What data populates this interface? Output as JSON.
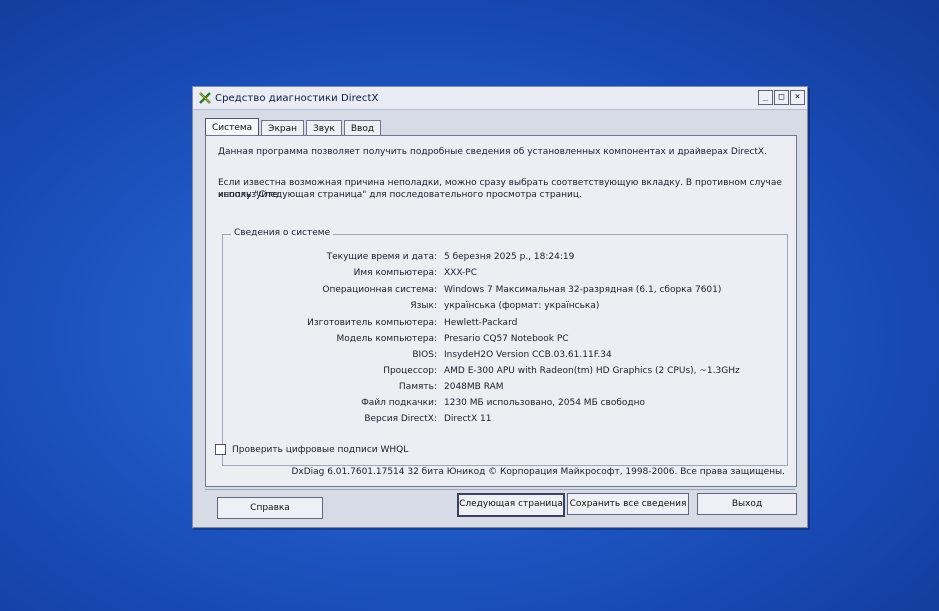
{
  "window": {
    "title": "Средство диагностики DirectX",
    "controls": {
      "minimize": "_",
      "maximize": "□",
      "close": "×"
    }
  },
  "tabs": [
    {
      "label": "Система",
      "active": true
    },
    {
      "label": "Экран",
      "active": false
    },
    {
      "label": "Звук",
      "active": false
    },
    {
      "label": "Ввод",
      "active": false
    }
  ],
  "intro": {
    "line1": "Данная программа позволяет получить подробные сведения об установленных компонентах и драйверах DirectX.",
    "line2": "Если известна возможная причина неполадки, можно сразу выбрать соответствующую вкладку. В противном случае используйте",
    "line3": "кнопку \"Следующая страница\" для последовательного просмотра страниц."
  },
  "system_info": {
    "group_label": "Сведения о системе",
    "rows": [
      {
        "label": "Текущие время и дата:",
        "value": "5 березня 2025 р., 18:24:19"
      },
      {
        "label": "Имя компьютера:",
        "value": "XXX-PC"
      },
      {
        "label": "Операционная система:",
        "value": "Windows 7 Максимальная 32-разрядная (6.1, сборка 7601)"
      },
      {
        "label": "Язык:",
        "value": "українська (формат: українська)"
      },
      {
        "label": "Изготовитель компьютера:",
        "value": "Hewlett-Packard"
      },
      {
        "label": "Модель компьютера:",
        "value": "Presario CQ57 Notebook PC"
      },
      {
        "label": "BIOS:",
        "value": "InsydeH2O Version CCB.03.61.11F.34"
      },
      {
        "label": "Процессор:",
        "value": "AMD E-300 APU with Radeon(tm) HD Graphics (2 CPUs), ~1.3GHz"
      },
      {
        "label": "Память:",
        "value": "2048MB RAM"
      },
      {
        "label": "Файл подкачки:",
        "value": "1230 МБ использовано, 2054 МБ свободно"
      },
      {
        "label": "Версия DirectX:",
        "value": "DirectX 11"
      }
    ]
  },
  "whql_checkbox": {
    "label": "Проверить цифровые подписи WHQL",
    "checked": false
  },
  "copyright": "DxDiag 6.01.7601.17514 32 бита Юникод  © Корпорация Майкрософт, 1998-2006.  Все права защищены.",
  "buttons": {
    "help": "Справка",
    "next": "Следующая страница",
    "save": "Сохранить все сведения",
    "exit": "Выход"
  },
  "colors": {
    "desktop": "#1f57c4",
    "window_bg": "#d6dbe6",
    "panel_bg": "#eceef4"
  }
}
